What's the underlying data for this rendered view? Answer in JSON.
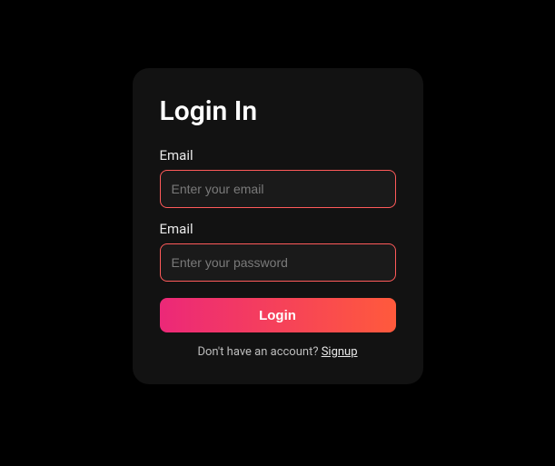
{
  "form": {
    "title": "Login In",
    "email": {
      "label": "Email",
      "placeholder": "Enter your email"
    },
    "password": {
      "label": "Email",
      "placeholder": "Enter your password"
    },
    "submit_label": "Login",
    "footer": {
      "text": "Don't have an account? ",
      "link_text": "Signup"
    }
  }
}
